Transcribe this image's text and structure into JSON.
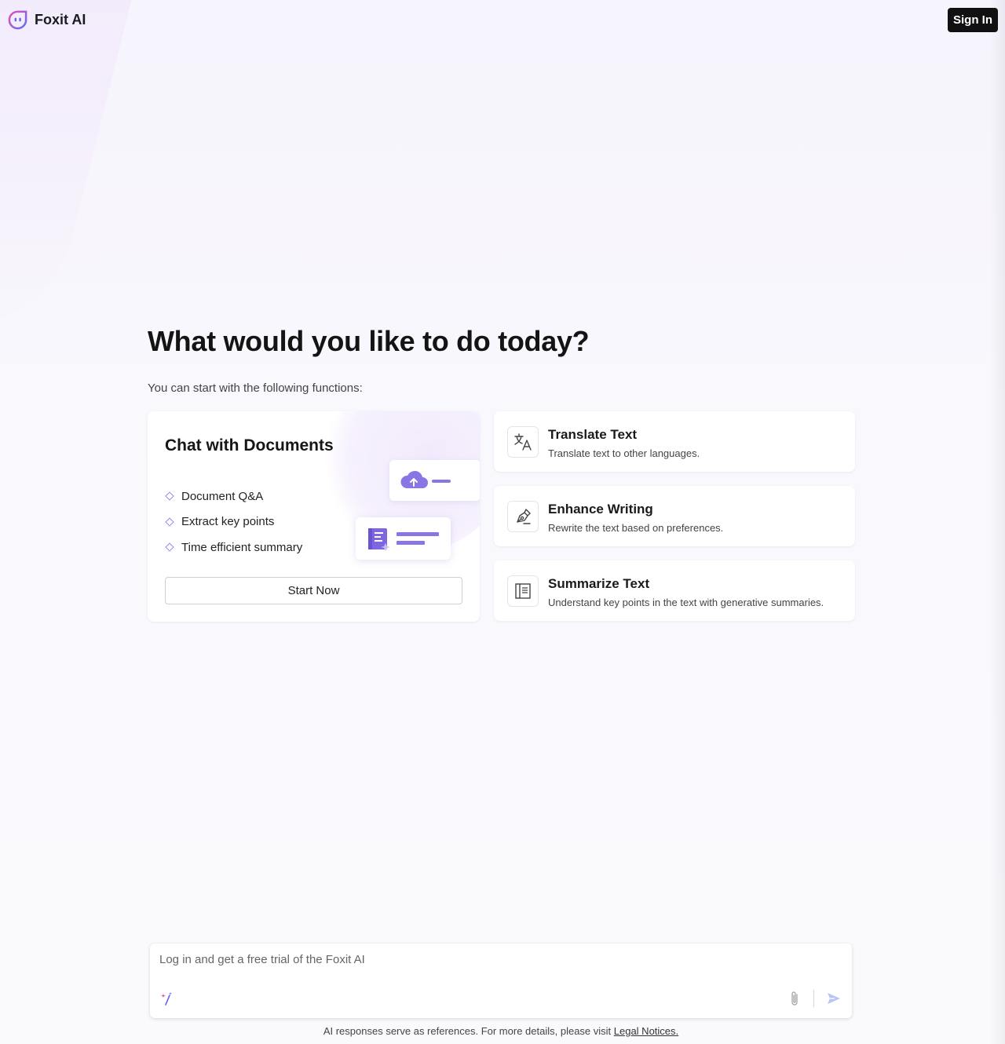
{
  "app": {
    "name": "Foxit AI"
  },
  "header": {
    "signin_label": "Sign In"
  },
  "main": {
    "headline": "What would you like to do today?",
    "subheading": "You can start with the following functions:"
  },
  "chat_card": {
    "title": "Chat with Documents",
    "features": [
      "Document Q&A",
      "Extract key points",
      "Time efficient summary"
    ],
    "start_label": "Start Now"
  },
  "functions": [
    {
      "title": "Translate Text",
      "description": "Translate text to other languages.",
      "icon": "translate-icon"
    },
    {
      "title": "Enhance Writing",
      "description": "Rewrite the text based on preferences.",
      "icon": "pen-icon"
    },
    {
      "title": "Summarize Text",
      "description": "Understand key points in the text with generative summaries.",
      "icon": "summary-icon"
    }
  ],
  "prompt": {
    "placeholder": "Log in and get a free trial of the Foxit AI"
  },
  "footer": {
    "text": "AI responses serve as references. For more details, please visit ",
    "link_label": "Legal Notices."
  },
  "colors": {
    "accent": "#8b74e4",
    "brand_pink": "#e44fb8",
    "brand_blue": "#5d6ef0",
    "button_dark": "#111111"
  }
}
